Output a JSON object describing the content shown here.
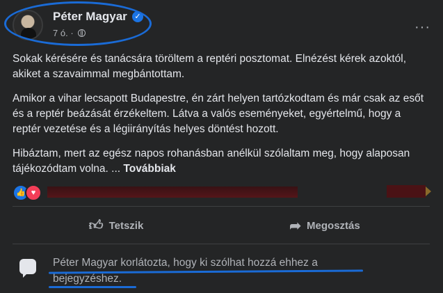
{
  "post": {
    "author": "Péter Magyar",
    "time": "7 ó.",
    "dot": "·",
    "paragraphs": [
      "Sokak kérésére és tanácsára töröltem a reptéri posztomat. Elnézést kérek azoktól, akiket a szavaimmal megbántottam.",
      "Amikor a vihar lecsapott Budapestre, én zárt helyen tartózkodtam és már csak az esőt és a reptér beázását érzékeltem. Látva a valós eseményeket, egyértelmű, hogy a reptér vezetése és a légiirányítás helyes döntést hozott.",
      "Hibáztam, mert az egész napos rohanásban anélkül szólaltam meg, hogy alaposan tájékozódtam volna. ..."
    ],
    "more_label": "Továbbiak"
  },
  "actions": {
    "like_label": "Tetszik",
    "share_label": "Megosztás"
  },
  "restricted": {
    "text": "Péter Magyar korlátozta, hogy ki szólhat hozzá ehhez a bejegyzéshez."
  },
  "icons": {
    "more": "more-horizontal-icon",
    "globe": "globe-icon",
    "verified": "verified-badge-icon",
    "like_reaction": "like-reaction-icon",
    "love_reaction": "love-reaction-icon",
    "like_button": "thumbs-up-icon",
    "share_button": "share-icon",
    "comment": "comment-bubble-icon"
  },
  "colors": {
    "background": "#242526",
    "text": "#e4e6eb",
    "secondary": "#b0b3b8",
    "accent": "#1b74e4",
    "annotation": "#1a6bd6"
  }
}
